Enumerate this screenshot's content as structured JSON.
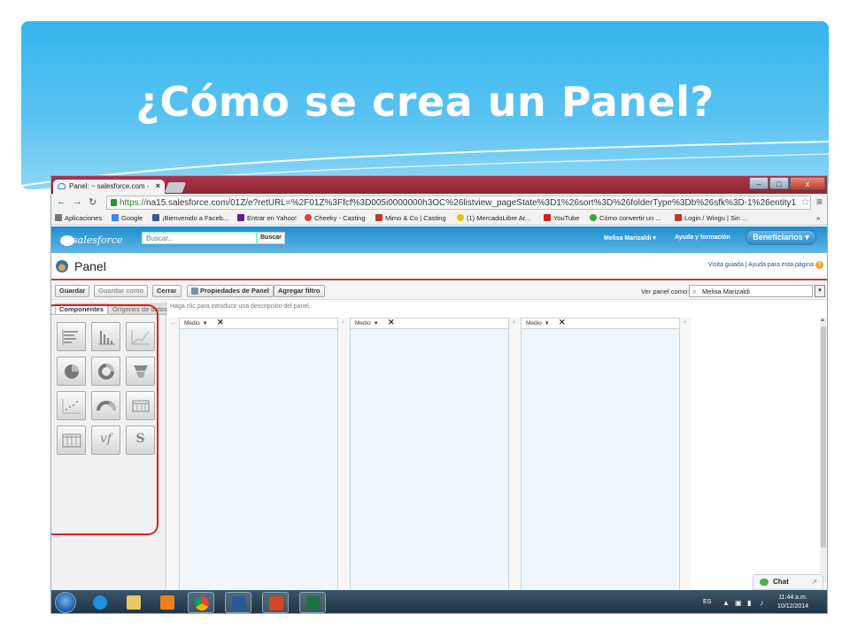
{
  "slide": {
    "title": "¿Cómo se crea un Panel?"
  },
  "browser": {
    "tab_title": "Panel: ~ salesforce.com -",
    "tab_close": "×",
    "url_scheme": "https://",
    "url_rest": "na15.salesforce.com/01Z/e?retURL=%2F01Z%3Ffcf%3D005i0000000h3OC%26listview_pageState%3D1%26sort%3D%26folderType%3Db%26sfk%3D-1%26entity1",
    "window_buttons": {
      "minimize": "–",
      "maximize": "□",
      "close": "x"
    },
    "bookmarks": [
      {
        "label": "Aplicaciones",
        "color": "#777777"
      },
      {
        "label": "Google",
        "color": "#4285f4"
      },
      {
        "label": "¡Bienvenido a Faceb...",
        "color": "#3b5998"
      },
      {
        "label": "Entrar en Yahoo!",
        "color": "#5a1f8a"
      },
      {
        "label": "Cheeky - Casting",
        "color": "#e23c3c"
      },
      {
        "label": "Mimo & Co | Casting",
        "color": "#c0392b"
      },
      {
        "label": "(1) MercadoLibre Ar...",
        "color": "#e8c100"
      },
      {
        "label": "YouTube",
        "color": "#d41f1f"
      },
      {
        "label": "Cómo convertir un ...",
        "color": "#3aa33a"
      },
      {
        "label": "Login / Wingu | Sin ...",
        "color": "#c0392b"
      }
    ],
    "bookmarks_more": "»"
  },
  "sf": {
    "logo_text": "salesforce",
    "search_placeholder": "Buscar...",
    "search_button": "Buscar",
    "user_menu": "Melisa Marizaldi ▾",
    "help_link": "Ayuda y formación",
    "app_menu": "Beneficiarios ▾",
    "page_title": "Panel",
    "page_links": "Visita guiada | Ayuda para esta página",
    "help_icon": "?"
  },
  "toolbar": {
    "save": "Guardar",
    "save_as": "Guardar como",
    "close": "Cerrar",
    "properties": "Propiedades de Panel",
    "add_filter": "Agregar filtro",
    "view_as_label": "Ver panel como:",
    "view_as_value": "Melisa Marizaldi",
    "dropdown": "▾"
  },
  "palette": {
    "tab_components": "Componentes",
    "tab_sources": "Orígenes de datos",
    "tiles": [
      {
        "name": "horizontal-bar-chart-tile",
        "icon": "horizontal-bar-icon"
      },
      {
        "name": "vertical-bar-chart-tile",
        "icon": "vertical-bar-icon"
      },
      {
        "name": "line-chart-tile",
        "icon": "line-chart-icon"
      },
      {
        "name": "pie-chart-tile",
        "icon": "pie-chart-icon"
      },
      {
        "name": "donut-chart-tile",
        "icon": "donut-chart-icon"
      },
      {
        "name": "funnel-chart-tile",
        "icon": "funnel-chart-icon"
      },
      {
        "name": "scatter-chart-tile",
        "icon": "scatter-chart-icon"
      },
      {
        "name": "gauge-tile",
        "icon": "gauge-icon"
      },
      {
        "name": "metric-tile",
        "icon": "metric-icon"
      },
      {
        "name": "table-tile",
        "icon": "table-icon"
      },
      {
        "name": "visualforce-tile",
        "icon": "visualforce-icon",
        "text": "vf"
      },
      {
        "name": "s-control-tile",
        "icon": "s-control-icon",
        "text": "S"
      }
    ]
  },
  "canvas": {
    "hint": "Haga clic para introducir una descripción del panel.",
    "gutter_symbol": "+",
    "left_gutter_symbol": "←",
    "columns": [
      {
        "width_label": "Medio",
        "caret": "▼",
        "remove": "✕"
      },
      {
        "width_label": "Medio",
        "caret": "▼",
        "remove": "✕"
      },
      {
        "width_label": "Medio",
        "caret": "▼",
        "remove": "✕"
      }
    ]
  },
  "chat": {
    "label": "Chat",
    "expand": "↗"
  },
  "taskbar": {
    "language": "ES",
    "time": "11:44 a.m.",
    "date": "10/12/2014",
    "apps": [
      {
        "name": "internet-explorer",
        "color": "#1e8fe1"
      },
      {
        "name": "file-explorer",
        "color": "#e8c867"
      },
      {
        "name": "media-player",
        "color": "#f07e1b"
      },
      {
        "name": "chrome",
        "color": "#dd4b39"
      },
      {
        "name": "word",
        "color": "#2b5797"
      },
      {
        "name": "powerpoint",
        "color": "#d24726"
      },
      {
        "name": "excel",
        "color": "#1e7145"
      }
    ]
  }
}
